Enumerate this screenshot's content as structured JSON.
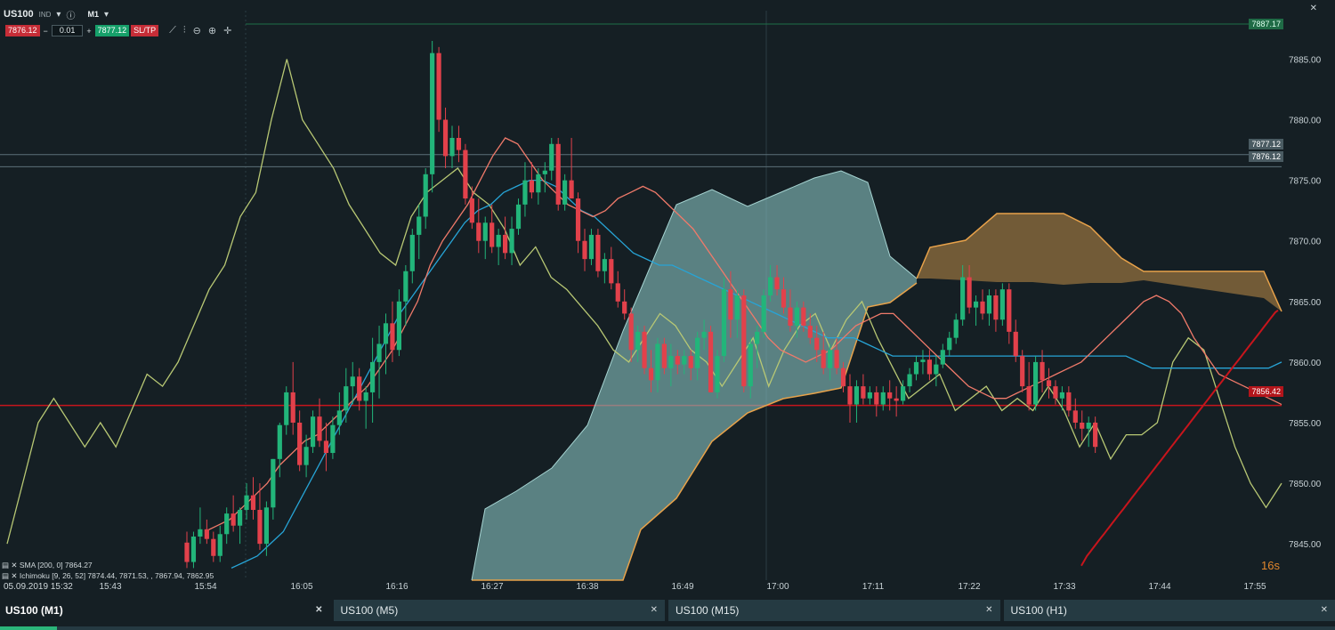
{
  "header": {
    "symbol": "US100",
    "symbol_type": "IND",
    "timeframe": "M1",
    "bid": "7876.12",
    "lot": "0.01",
    "ask": "7877.12",
    "sltp": "SL/TP"
  },
  "price_tags": {
    "top_line": "7887.17",
    "ask_line": "7877.12",
    "bid_line": "7876.12",
    "current": "7856.42"
  },
  "legend": {
    "sma": "SMA [200, 0] 7864.27",
    "ichimoku": "Ichimoku [9, 26, 52] 7874.44, 7871.53, , 7867.94, 7862.95"
  },
  "date_label": "05.09.2019 15:32",
  "countdown": "16s",
  "tabs": [
    {
      "label": "US100 (M1)",
      "active": true
    },
    {
      "label": "US100 (M5)",
      "active": false
    },
    {
      "label": "US100 (M15)",
      "active": false
    },
    {
      "label": "US100 (H1)",
      "active": false
    }
  ],
  "chart_data": {
    "type": "candlestick",
    "ylim": [
      7842,
      7889
    ],
    "y_ticks": [
      7845.0,
      7850.0,
      7855.0,
      7860.0,
      7865.0,
      7870.0,
      7875.0,
      7880.0,
      7885.0
    ],
    "x_ticks": [
      "15:43",
      "15:54",
      "16:05",
      "16:16",
      "16:27",
      "16:38",
      "16:49",
      "17:00",
      "17:11",
      "17:22",
      "17:33",
      "17:44",
      "17:55"
    ],
    "candles": [
      [
        7845.1,
        7846.0,
        7843.0,
        7843.5
      ],
      [
        7843.5,
        7846.0,
        7843.0,
        7845.6
      ],
      [
        7845.6,
        7848.0,
        7845.0,
        7846.2
      ],
      [
        7846.2,
        7847.0,
        7845.0,
        7845.4
      ],
      [
        7845.4,
        7846.0,
        7843.5,
        7844.0
      ],
      [
        7844.0,
        7846.5,
        7843.5,
        7845.8
      ],
      [
        7845.8,
        7848.0,
        7845.0,
        7847.5
      ],
      [
        7847.5,
        7849.0,
        7846.0,
        7846.5
      ],
      [
        7846.5,
        7848.0,
        7845.0,
        7847.8
      ],
      [
        7847.8,
        7850.0,
        7847.0,
        7849.0
      ],
      [
        7849.0,
        7850.5,
        7847.0,
        7847.8
      ],
      [
        7847.8,
        7850.0,
        7844.5,
        7845.0
      ],
      [
        7845.0,
        7848.5,
        7844.0,
        7848.0
      ],
      [
        7848.0,
        7852.0,
        7847.0,
        7852.0
      ],
      [
        7852.0,
        7855.0,
        7850.5,
        7854.8
      ],
      [
        7854.8,
        7858.0,
        7854.0,
        7857.5
      ],
      [
        7857.5,
        7860.0,
        7854.0,
        7855.0
      ],
      [
        7855.0,
        7856.0,
        7851.0,
        7851.5
      ],
      [
        7851.5,
        7854.0,
        7850.5,
        7853.0
      ],
      [
        7853.0,
        7856.0,
        7852.5,
        7855.5
      ],
      [
        7855.5,
        7857.0,
        7853.0,
        7853.5
      ],
      [
        7853.5,
        7855.0,
        7851.0,
        7852.5
      ],
      [
        7852.5,
        7855.5,
        7852.0,
        7854.8
      ],
      [
        7854.8,
        7857.5,
        7854.0,
        7856.0
      ],
      [
        7856.0,
        7859.5,
        7855.0,
        7858.0
      ],
      [
        7858.0,
        7860.0,
        7856.5,
        7858.8
      ],
      [
        7858.8,
        7859.5,
        7856.0,
        7856.8
      ],
      [
        7856.8,
        7858.0,
        7854.5,
        7857.5
      ],
      [
        7857.5,
        7862.0,
        7855.0,
        7860.0
      ],
      [
        7860.0,
        7863.0,
        7857.0,
        7861.5
      ],
      [
        7861.5,
        7864.0,
        7859.0,
        7863.2
      ],
      [
        7863.2,
        7865.0,
        7860.0,
        7861.0
      ],
      [
        7861.0,
        7866.0,
        7860.5,
        7865.0
      ],
      [
        7865.0,
        7868.0,
        7863.0,
        7867.5
      ],
      [
        7867.5,
        7871.0,
        7866.5,
        7870.5
      ],
      [
        7870.5,
        7873.0,
        7868.5,
        7872.0
      ],
      [
        7872.0,
        7876.0,
        7871.0,
        7875.5
      ],
      [
        7875.5,
        7886.5,
        7874.0,
        7885.5
      ],
      [
        7885.5,
        7886.0,
        7879.0,
        7880.0
      ],
      [
        7880.0,
        7881.0,
        7876.0,
        7877.0
      ],
      [
        7877.0,
        7879.5,
        7876.0,
        7878.5
      ],
      [
        7878.5,
        7879.5,
        7876.5,
        7877.5
      ],
      [
        7877.5,
        7878.0,
        7873.0,
        7873.5
      ],
      [
        7873.5,
        7874.5,
        7871.0,
        7871.5
      ],
      [
        7871.5,
        7873.5,
        7869.0,
        7870.0
      ],
      [
        7870.0,
        7872.0,
        7868.5,
        7871.5
      ],
      [
        7871.5,
        7873.0,
        7869.0,
        7869.5
      ],
      [
        7869.5,
        7871.0,
        7868.0,
        7870.5
      ],
      [
        7870.5,
        7872.0,
        7868.5,
        7869.0
      ],
      [
        7869.0,
        7872.0,
        7868.0,
        7871.0
      ],
      [
        7871.0,
        7873.5,
        7870.5,
        7873.0
      ],
      [
        7873.0,
        7876.5,
        7872.0,
        7875.0
      ],
      [
        7875.0,
        7876.5,
        7873.5,
        7874.0
      ],
      [
        7874.0,
        7876.0,
        7873.0,
        7875.5
      ],
      [
        7875.5,
        7876.5,
        7874.0,
        7875.8
      ],
      [
        7875.8,
        7878.5,
        7875.0,
        7878.0
      ],
      [
        7878.0,
        7878.5,
        7872.5,
        7873.0
      ],
      [
        7873.0,
        7875.5,
        7872.5,
        7875.0
      ],
      [
        7875.0,
        7878.5,
        7874.5,
        7873.5
      ],
      [
        7873.5,
        7874.0,
        7869.0,
        7870.0
      ],
      [
        7870.0,
        7871.0,
        7867.5,
        7868.5
      ],
      [
        7868.5,
        7871.0,
        7868.0,
        7870.5
      ],
      [
        7870.5,
        7871.0,
        7867.0,
        7867.5
      ],
      [
        7867.5,
        7869.0,
        7866.5,
        7868.5
      ],
      [
        7868.5,
        7869.5,
        7866.0,
        7866.5
      ],
      [
        7866.5,
        7867.5,
        7864.5,
        7865.0
      ],
      [
        7865.0,
        7866.0,
        7863.5,
        7864.0
      ],
      [
        7864.0,
        7864.5,
        7860.0,
        7861.0
      ],
      [
        7861.0,
        7863.0,
        7860.0,
        7862.5
      ],
      [
        7862.5,
        7863.0,
        7859.0,
        7859.5
      ],
      [
        7859.5,
        7861.0,
        7857.5,
        7858.5
      ],
      [
        7858.5,
        7862.0,
        7857.5,
        7861.5
      ],
      [
        7861.5,
        7862.0,
        7859.0,
        7859.5
      ],
      [
        7859.5,
        7861.5,
        7858.0,
        7860.5
      ],
      [
        7860.5,
        7861.0,
        7859.0,
        7859.8
      ],
      [
        7859.8,
        7861.0,
        7859.0,
        7860.5
      ],
      [
        7860.5,
        7861.0,
        7858.5,
        7859.5
      ],
      [
        7859.5,
        7862.5,
        7858.5,
        7862.0
      ],
      [
        7862.0,
        7863.5,
        7861.0,
        7862.5
      ],
      [
        7862.5,
        7863.0,
        7857.5,
        7857.5
      ],
      [
        7857.5,
        7861.0,
        7857.0,
        7860.5
      ],
      [
        7860.5,
        7867.0,
        7860.0,
        7866.0
      ],
      [
        7866.0,
        7867.5,
        7862.0,
        7863.5
      ],
      [
        7863.5,
        7866.0,
        7862.0,
        7865.5
      ],
      [
        7865.5,
        7866.0,
        7857.5,
        7858.0
      ],
      [
        7858.0,
        7862.0,
        7857.0,
        7861.5
      ],
      [
        7861.5,
        7863.0,
        7859.5,
        7862.5
      ],
      [
        7862.5,
        7866.0,
        7862.0,
        7865.5
      ],
      [
        7865.5,
        7868.0,
        7865.0,
        7867.0
      ],
      [
        7867.0,
        7868.0,
        7865.5,
        7866.0
      ],
      [
        7866.0,
        7867.0,
        7864.0,
        7864.5
      ],
      [
        7864.5,
        7866.0,
        7862.5,
        7863.0
      ],
      [
        7863.0,
        7865.0,
        7862.0,
        7864.5
      ],
      [
        7864.5,
        7865.0,
        7862.5,
        7863.0
      ],
      [
        7863.0,
        7864.0,
        7861.5,
        7862.0
      ],
      [
        7862.0,
        7863.0,
        7860.0,
        7861.0
      ],
      [
        7861.0,
        7862.5,
        7859.0,
        7859.5
      ],
      [
        7859.5,
        7861.5,
        7858.5,
        7861.0
      ],
      [
        7861.0,
        7862.0,
        7859.0,
        7859.5
      ],
      [
        7859.5,
        7860.0,
        7857.5,
        7858.0
      ],
      [
        7858.0,
        7859.0,
        7855.0,
        7856.5
      ],
      [
        7856.5,
        7858.5,
        7855.0,
        7858.0
      ],
      [
        7858.0,
        7859.0,
        7856.5,
        7857.0
      ],
      [
        7857.0,
        7858.0,
        7856.5,
        7857.5
      ],
      [
        7857.5,
        7858.0,
        7855.5,
        7856.5
      ],
      [
        7856.5,
        7858.0,
        7856.0,
        7857.5
      ],
      [
        7857.5,
        7858.5,
        7856.0,
        7857.0
      ],
      [
        7857.0,
        7858.0,
        7855.5,
        7856.8
      ],
      [
        7856.8,
        7858.5,
        7856.5,
        7858.0
      ],
      [
        7858.0,
        7859.5,
        7857.5,
        7859.0
      ],
      [
        7859.0,
        7860.5,
        7858.5,
        7860.0
      ],
      [
        7860.0,
        7861.0,
        7859.0,
        7860.2
      ],
      [
        7860.2,
        7861.0,
        7858.5,
        7859.0
      ],
      [
        7859.0,
        7860.5,
        7858.0,
        7859.8
      ],
      [
        7859.8,
        7861.5,
        7859.5,
        7861.0
      ],
      [
        7861.0,
        7862.5,
        7860.5,
        7862.0
      ],
      [
        7862.0,
        7864.0,
        7861.5,
        7863.5
      ],
      [
        7863.5,
        7868.0,
        7863.0,
        7867.0
      ],
      [
        7867.0,
        7868.0,
        7864.0,
        7864.5
      ],
      [
        7864.5,
        7865.5,
        7863.0,
        7865.0
      ],
      [
        7865.0,
        7866.0,
        7863.5,
        7864.0
      ],
      [
        7864.0,
        7866.0,
        7863.0,
        7865.5
      ],
      [
        7865.5,
        7866.0,
        7862.5,
        7863.5
      ],
      [
        7863.5,
        7866.5,
        7863.0,
        7866.0
      ],
      [
        7866.0,
        7866.5,
        7861.5,
        7862.5
      ],
      [
        7862.5,
        7863.5,
        7860.0,
        7860.5
      ],
      [
        7860.5,
        7861.0,
        7857.5,
        7858.0
      ],
      [
        7858.0,
        7860.0,
        7856.0,
        7856.5
      ],
      [
        7856.5,
        7860.5,
        7856.0,
        7860.0
      ],
      [
        7860.0,
        7861.0,
        7857.5,
        7858.5
      ],
      [
        7858.5,
        7859.5,
        7857.0,
        7858.0
      ],
      [
        7858.0,
        7858.5,
        7856.5,
        7857.0
      ],
      [
        7857.0,
        7858.0,
        7856.0,
        7857.5
      ],
      [
        7857.5,
        7858.0,
        7855.5,
        7856.0
      ],
      [
        7856.0,
        7857.0,
        7854.5,
        7855.0
      ],
      [
        7855.0,
        7856.0,
        7853.5,
        7854.5
      ],
      [
        7854.5,
        7855.5,
        7853.0,
        7855.0
      ],
      [
        7855.0,
        7855.5,
        7852.5,
        7853.0
      ]
    ],
    "sma": [
      7843.2,
      7843.6,
      7844.0,
      7844.3,
      7844.6,
      7844.9,
      7845.2,
      7845.5,
      7845.8,
      7846.1,
      7846.4,
      7846.7,
      7847.0,
      7847.3,
      7847.6,
      7847.9,
      7848.2,
      7848.5,
      7848.8,
      7849.1,
      7849.4,
      7849.7,
      7850.0,
      7850.3,
      7850.6,
      7850.9,
      7851.2,
      7851.5,
      7851.8,
      7852.1,
      7852.4,
      7852.7,
      7853.0,
      7853.3,
      7853.6,
      7853.9,
      7854.2,
      7854.5,
      7854.8,
      7855.1,
      7855.4,
      7855.7,
      7856.0,
      7856.3,
      7856.6,
      7856.9,
      7857.2,
      7857.5,
      7857.8,
      7858.1,
      7858.4,
      7858.7,
      7859.0,
      7859.3,
      7859.6,
      7859.9,
      7860.2,
      7860.5,
      7860.8,
      7861.1,
      7861.4,
      7861.7,
      7862.0,
      7862.3,
      7862.6,
      7862.9,
      7863.2,
      7863.5,
      7863.8,
      7864.1,
      7864.27
    ],
    "tenkan": [
      7846.0,
      7846.5,
      7847.0,
      7848.0,
      7849.0,
      7850.0,
      7851.5,
      7852.5,
      7853.5,
      7854.0,
      7855.0,
      7856.0,
      7857.0,
      7858.0,
      7859.5,
      7861.0,
      7863.0,
      7865.0,
      7868.0,
      7870.0,
      7871.5,
      7873.0,
      7875.0,
      7877.0,
      7878.5,
      7878.0,
      7876.5,
      7875.0,
      7874.0,
      7873.0,
      7872.5,
      7872.0,
      7872.5,
      7873.5,
      7874.0,
      7874.5,
      7874.0,
      7873.0,
      7872.0,
      7871.0,
      7869.5,
      7868.0,
      7866.5,
      7865.0,
      7863.5,
      7862.0,
      7861.0,
      7860.5,
      7860.0,
      7860.5,
      7861.0,
      7862.0,
      7863.0,
      7863.5,
      7864.0,
      7864.0,
      7863.0,
      7862.0,
      7861.0,
      7860.0,
      7859.0,
      7858.0,
      7857.5,
      7857.0,
      7857.0,
      7857.5,
      7858.0,
      7858.5,
      7859.0,
      7859.5,
      7860.0,
      7861.0,
      7862.0,
      7863.0,
      7864.0,
      7865.0,
      7865.5,
      7865.0,
      7864.0,
      7862.0,
      7860.5,
      7859.0,
      7858.5,
      7858.0,
      7857.5,
      7857.0,
      7856.5
    ],
    "kijun": [
      7843.0,
      7843.5,
      7844.0,
      7845.0,
      7846.0,
      7848.0,
      7850.0,
      7852.0,
      7854.0,
      7856.0,
      7858.0,
      7860.0,
      7862.0,
      7864.0,
      7865.5,
      7867.0,
      7868.5,
      7870.0,
      7871.5,
      7872.5,
      7873.0,
      7874.0,
      7874.5,
      7875.0,
      7875.0,
      7874.5,
      7873.5,
      7872.5,
      7872.0,
      7871.0,
      7870.0,
      7869.0,
      7868.5,
      7868.0,
      7868.0,
      7867.5,
      7867.0,
      7866.5,
      7866.0,
      7865.5,
      7865.0,
      7864.5,
      7864.0,
      7863.5,
      7863.0,
      7862.5,
      7862.0,
      7862.0,
      7862.0,
      7861.5,
      7861.0,
      7860.5,
      7860.5,
      7860.5,
      7860.5,
      7860.5,
      7860.5,
      7860.5,
      7860.5,
      7860.5,
      7860.5,
      7860.5,
      7860.5,
      7860.5,
      7860.5,
      7860.5,
      7860.5,
      7860.5,
      7860.5,
      7860.5,
      7860.0,
      7859.5,
      7859.5,
      7859.5,
      7859.5,
      7859.5,
      7859.5,
      7859.5,
      7859.5,
      7859.5,
      7859.5,
      7860.0
    ],
    "chikou": [
      7845.0,
      7850.0,
      7855.0,
      7857.0,
      7855.0,
      7853.0,
      7855.0,
      7853.0,
      7856.0,
      7859.0,
      7858.0,
      7860.0,
      7863.0,
      7866.0,
      7868.0,
      7872.0,
      7874.0,
      7880.0,
      7885.0,
      7880.0,
      7878.0,
      7876.0,
      7873.0,
      7871.0,
      7869.0,
      7868.0,
      7872.0,
      7874.0,
      7875.0,
      7876.0,
      7874.0,
      7873.0,
      7871.0,
      7868.0,
      7869.5,
      7867.0,
      7866.0,
      7864.5,
      7863.0,
      7861.0,
      7860.0,
      7862.0,
      7864.0,
      7863.0,
      7861.0,
      7860.0,
      7858.0,
      7860.0,
      7862.0,
      7858.0,
      7861.0,
      7863.0,
      7864.0,
      7861.0,
      7863.5,
      7865.0,
      7862.0,
      7859.5,
      7857.0,
      7858.0,
      7859.0,
      7856.0,
      7857.0,
      7858.0,
      7856.0,
      7857.0,
      7856.0,
      7858.0,
      7856.0,
      7853.0,
      7855.0,
      7852.0,
      7854.0,
      7854.0,
      7855.0,
      7860.0,
      7862.0,
      7861.0,
      7857.0,
      7853.0,
      7850.0,
      7848.0,
      7850.0
    ]
  }
}
